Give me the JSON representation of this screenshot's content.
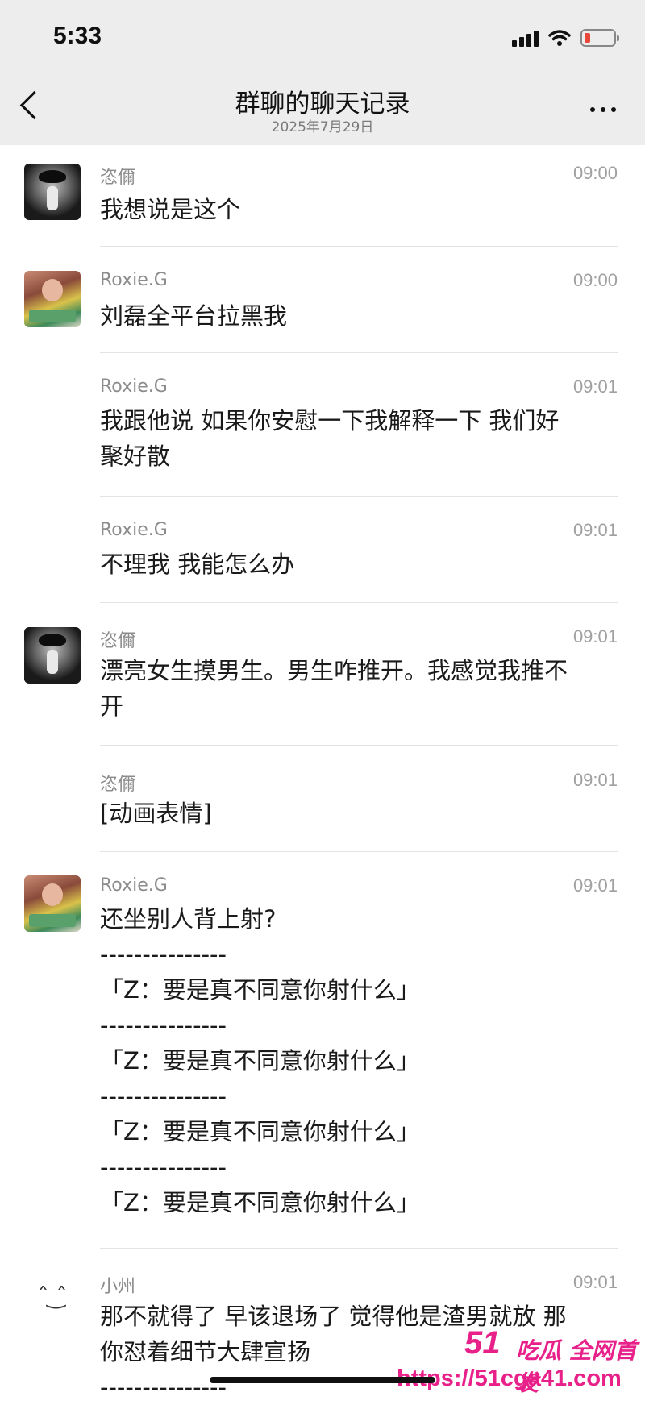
{
  "status_bar": {
    "time": "5:33"
  },
  "header": {
    "title": "群聊的聊天记录",
    "subtitle": "2025年7月29日"
  },
  "messages": [
    {
      "sender": "恣儞",
      "time": "09:00",
      "text": "我想说是这个",
      "avatar": "dark-portrait-avatar"
    },
    {
      "sender": "Roxie.G",
      "time": "09:00",
      "text": "刘磊全平台拉黑我",
      "avatar": "color-portrait-avatar"
    },
    {
      "sender": "Roxie.G",
      "time": "09:01",
      "text": "我跟他说 如果你安慰一下我解释一下 我们好\n聚好散"
    },
    {
      "sender": "Roxie.G",
      "time": "09:01",
      "text": "不理我 我能怎么办"
    },
    {
      "sender": "恣儞",
      "time": "09:01",
      "text": "漂亮女生摸男生。男生咋推开。我感觉我推不\n开",
      "avatar": "dark-portrait-avatar"
    },
    {
      "sender": "恣儞",
      "time": "09:01",
      "text": "[动画表情]"
    },
    {
      "sender": "Roxie.G",
      "time": "09:01",
      "text": "还坐别人背上射?\n---------------\n「Z：要是真不同意你射什么」\n---------------\n「Z：要是真不同意你射什么」\n---------------\n「Z：要是真不同意你射什么」\n---------------\n「Z：要是真不同意你射什么」",
      "avatar": "color-portrait-avatar"
    },
    {
      "sender": "小州",
      "time": "09:01",
      "text": "那不就得了 早该退场了 觉得他是渣男就放 那\n你怼着细节大肆宣扬\n---------------",
      "avatar": "face-emoticon-avatar",
      "avatar_glyph": "ˆ ͜ˆ"
    }
  ],
  "watermark": {
    "brand": "51",
    "slogan": "吃瓜 全网首发",
    "url": "https://51cga41.com"
  },
  "colors": {
    "header_bg": "#ededed",
    "watermark": "#e8218a",
    "battery_low": "#e8473a"
  }
}
